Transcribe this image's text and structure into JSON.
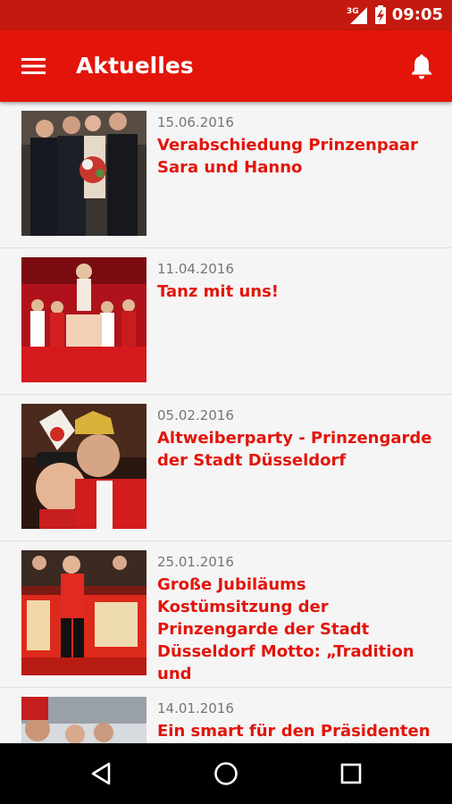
{
  "status_bar": {
    "network": "3G",
    "time": "09:05"
  },
  "app_bar": {
    "title": "Aktuelles",
    "menu_icon": "hamburger-menu-icon",
    "notification_icon": "bell-icon"
  },
  "news": [
    {
      "date": "15.06.2016",
      "title": "Verabschiedung Prinzenpaar Sara und Hanno"
    },
    {
      "date": "11.04.2016",
      "title": "Tanz mit uns!"
    },
    {
      "date": "05.02.2016",
      "title": "Altweiberparty - Prinzengarde der Stadt Düsseldorf"
    },
    {
      "date": "25.01.2016",
      "title": "Große Jubiläums Kostümsitzung der Prinzengarde der Stadt Düsseldorf Motto: „Tradition und"
    },
    {
      "date": "14.01.2016",
      "title": "Ein smart für den Präsidenten"
    }
  ],
  "colors": {
    "primary": "#e3150b",
    "status_bar": "#c4190f",
    "background": "#f5f5f5"
  }
}
